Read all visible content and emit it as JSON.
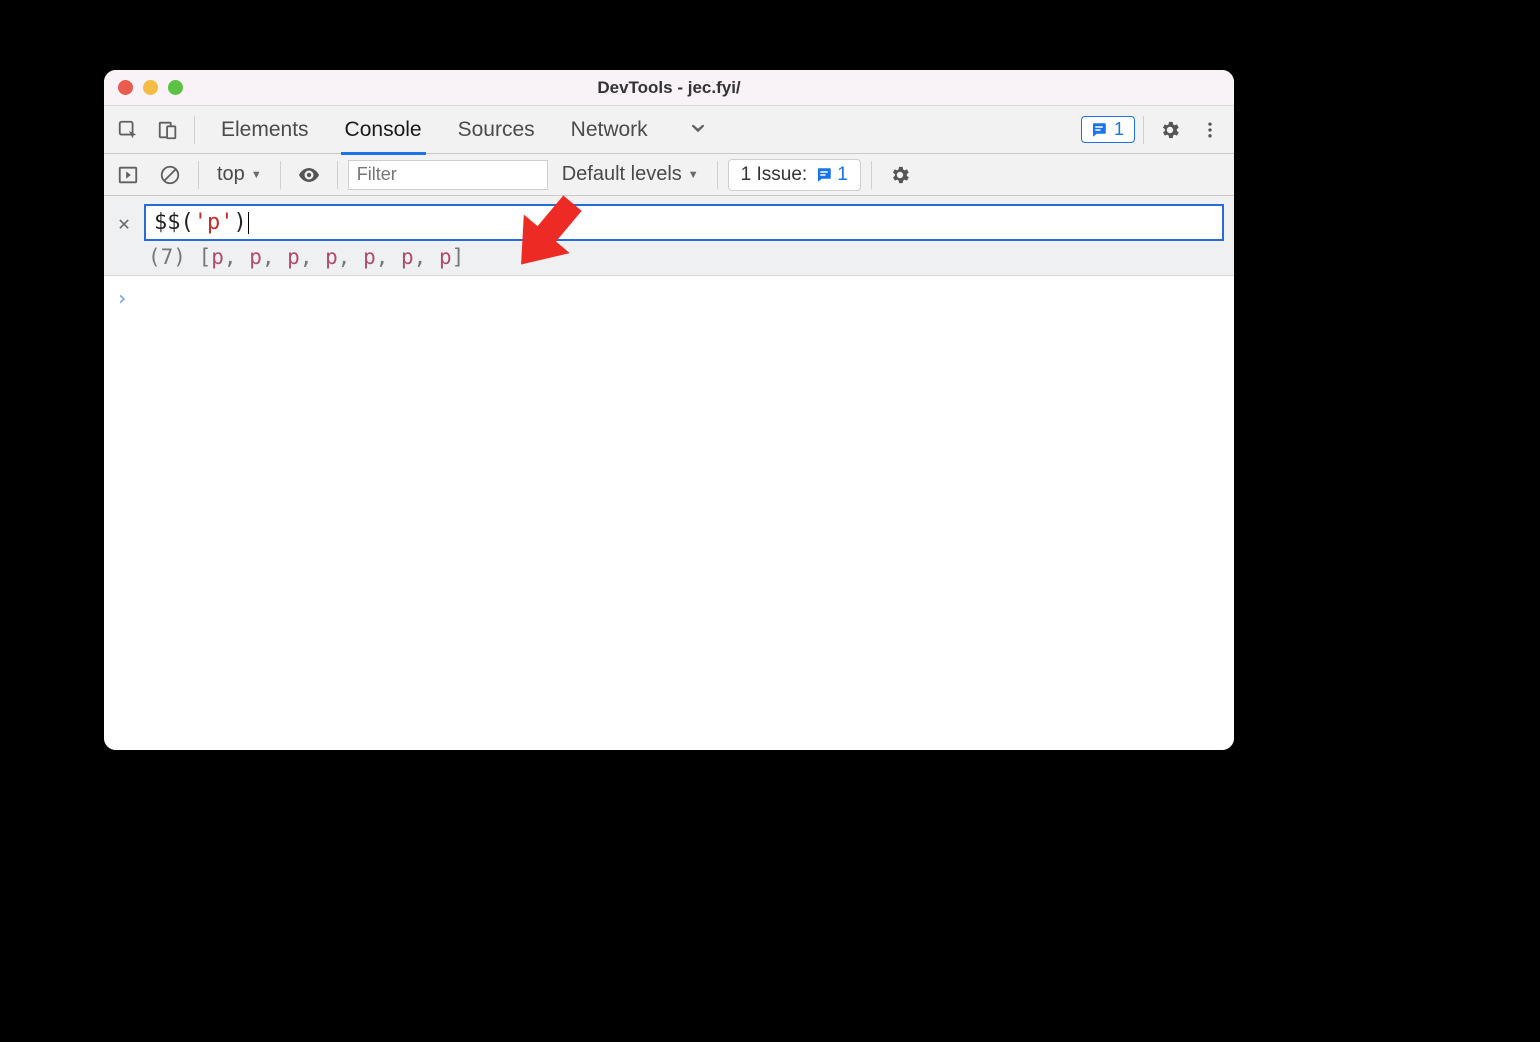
{
  "window": {
    "title": "DevTools - jec.fyi/"
  },
  "tabs": {
    "elements": "Elements",
    "console": "Console",
    "sources": "Sources",
    "network": "Network"
  },
  "feedback": {
    "count": "1"
  },
  "subbar": {
    "context": "top",
    "filter_placeholder": "Filter",
    "levels": "Default levels",
    "issues_label": "1 Issue:",
    "issues_count": "1"
  },
  "expression": {
    "fn": "$$",
    "open": "(",
    "string": "'p'",
    "close": ")",
    "result_count": "(7)",
    "result_open": "[",
    "result_items": [
      "p",
      "p",
      "p",
      "p",
      "p",
      "p",
      "p"
    ],
    "result_close": "]"
  }
}
